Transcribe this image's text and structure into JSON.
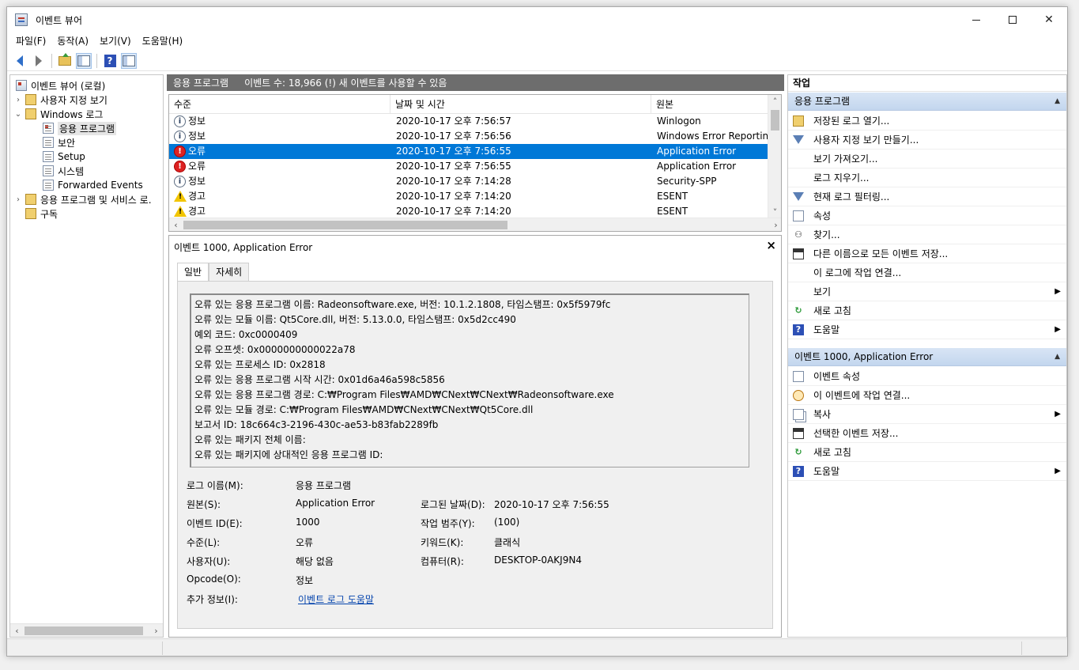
{
  "window": {
    "title": "이벤트 뷰어",
    "controls": {
      "minimize": "—",
      "maximize": "☐",
      "close": "✕"
    }
  },
  "menu": [
    "파일(F)",
    "동작(A)",
    "보기(V)",
    "도움말(H)"
  ],
  "toolbar": {
    "icons": [
      "back-arrow-icon",
      "forward-arrow-icon",
      "up-folder-icon",
      "show-hide-tree-icon",
      "help-icon",
      "show-hide-action-pane-icon"
    ]
  },
  "tree": {
    "root": "이벤트 뷰어 (로컬)",
    "custom_views": "사용자 지정 보기",
    "windows_logs": "Windows 로그",
    "logs": [
      "응용 프로그램",
      "보안",
      "Setup",
      "시스템",
      "Forwarded Events"
    ],
    "app_services": "응용 프로그램 및 서비스 로.",
    "subscriptions": "구독",
    "selected": "응용 프로그램"
  },
  "center": {
    "header_title": "응용 프로그램",
    "header_sub": "이벤트 수: 18,966 (!) 새 이벤트를 사용할 수 있음",
    "columns": [
      "수준",
      "날짜 및 시간",
      "원본"
    ],
    "rows": [
      {
        "level": "정보",
        "type": "info",
        "datetime": "2020-10-17 오후 7:56:57",
        "source": "Winlogon"
      },
      {
        "level": "정보",
        "type": "info",
        "datetime": "2020-10-17 오후 7:56:56",
        "source": "Windows Error Reporting"
      },
      {
        "level": "오류",
        "type": "error",
        "datetime": "2020-10-17 오후 7:56:55",
        "source": "Application Error",
        "selected": true
      },
      {
        "level": "오류",
        "type": "error",
        "datetime": "2020-10-17 오후 7:56:55",
        "source": "Application Error"
      },
      {
        "level": "정보",
        "type": "info",
        "datetime": "2020-10-17 오후 7:14:28",
        "source": "Security-SPP"
      },
      {
        "level": "경고",
        "type": "warning",
        "datetime": "2020-10-17 오후 7:14:20",
        "source": "ESENT"
      },
      {
        "level": "경고",
        "type": "warning",
        "datetime": "2020-10-17 오후 7:14:20",
        "source": "ESENT"
      }
    ]
  },
  "detail": {
    "title": "이벤트 1000, Application Error",
    "close": "×",
    "tabs": [
      "일반",
      "자세히"
    ],
    "description": [
      "오류 있는 응용 프로그램 이름: Radeonsoftware.exe, 버전: 10.1.2.1808, 타임스탬프: 0x5f5979fc",
      "오류 있는 모듈 이름: Qt5Core.dll, 버전: 5.13.0.0, 타임스탬프: 0x5d2cc490",
      "예외 코드: 0xc0000409",
      "오류 오프셋: 0x0000000000022a78",
      "오류 있는 프로세스 ID: 0x2818",
      "오류 있는 응용 프로그램 시작 시간: 0x01d6a46a598c5856",
      "오류 있는 응용 프로그램 경로: C:₩Program Files₩AMD₩CNext₩CNext₩Radeonsoftware.exe",
      "오류 있는 모듈 경로: C:₩Program Files₩AMD₩CNext₩CNext₩Qt5Core.dll",
      "보고서 ID: 18c664c3-2196-430c-ae53-b83fab2289fb",
      "오류 있는 패키지 전체 이름:",
      "오류 있는 패키지에 상대적인 응용 프로그램 ID:"
    ],
    "props": {
      "log_name_label": "로그 이름(M):",
      "log_name": "응용 프로그램",
      "source_label": "원본(S):",
      "source": "Application Error",
      "logged_label": "로그된 날짜(D):",
      "logged": "2020-10-17 오후 7:56:55",
      "event_id_label": "이벤트 ID(E):",
      "event_id": "1000",
      "task_label": "작업 범주(Y):",
      "task": "(100)",
      "level_label": "수준(L):",
      "level": "오류",
      "keywords_label": "키워드(K):",
      "keywords": "클래식",
      "user_label": "사용자(U):",
      "user": "해당 없음",
      "computer_label": "컴퓨터(R):",
      "computer": "DESKTOP-0AKJ9N4",
      "opcode_label": "Opcode(O):",
      "opcode": "정보",
      "more_info_label": "추가 정보(I):",
      "more_info": "이벤트 로그 도움말"
    }
  },
  "actions": {
    "title": "작업",
    "section1": "응용 프로그램",
    "items1": [
      "저장된 로그 열기...",
      "사용자 지정 보기 만들기...",
      "보기 가져오기...",
      "로그 지우기...",
      "현재 로그 필터링...",
      "속성",
      "찾기...",
      "다른 이름으로 모든 이벤트 저장...",
      "이 로그에 작업 연결...",
      "보기",
      "새로 고침",
      "도움말"
    ],
    "section2": "이벤트 1000, Application Error",
    "items2": [
      "이벤트 속성",
      "이 이벤트에 작업 연결...",
      "복사",
      "선택한 이벤트 저장...",
      "새로 고침",
      "도움말"
    ]
  }
}
